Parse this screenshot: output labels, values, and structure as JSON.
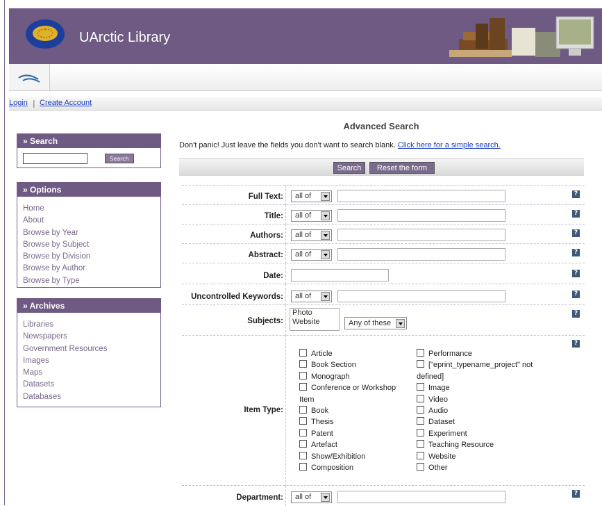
{
  "header": {
    "title": "UArctic Library"
  },
  "account": {
    "login": "Login",
    "separator": "|",
    "create": "Create Account"
  },
  "sidebar": {
    "search": {
      "heading": "» Search",
      "button": "Search"
    },
    "options": {
      "heading": "» Options",
      "items": [
        "Home",
        "About",
        "Browse by Year",
        "Browse by Subject",
        "Browse by Division",
        "Browse by Author",
        "Browse by Type"
      ]
    },
    "archives": {
      "heading": "» Archives",
      "items": [
        "Libraries",
        "Newspapers",
        "Government Resources",
        "Images",
        "Maps",
        "Datasets",
        "Databases"
      ]
    }
  },
  "main": {
    "title": "Advanced Search",
    "notice": "Don't panic! Just leave the fields you don't want to search blank.",
    "simple_link": "Click here for a simple search.",
    "search_button": "Search",
    "reset_button": "Reset the form",
    "help": "?",
    "fields": {
      "fulltext": {
        "label": "Full Text:",
        "select": "all of"
      },
      "title": {
        "label": "Title:",
        "select": "all of"
      },
      "authors": {
        "label": "Authors:",
        "select": "all of"
      },
      "abstract": {
        "label": "Abstract:",
        "select": "all of"
      },
      "date": {
        "label": "Date:"
      },
      "keywords": {
        "label": "Uncontrolled Keywords:",
        "select": "all of"
      },
      "subjects": {
        "label": "Subjects:",
        "options": [
          "Photo",
          "Website"
        ],
        "select": "Any of these"
      },
      "itemtype": {
        "label": "Item Type:"
      },
      "department": {
        "label": "Department:",
        "select": "all of"
      }
    },
    "item_types_left": [
      "Article",
      "Book Section",
      "Monograph",
      "Conference or Workshop Item",
      "Book",
      "Thesis",
      "Patent",
      "Artefact",
      "Show/Exhibition",
      "Composition"
    ],
    "item_types_right": [
      "Performance",
      "[\"eprint_typename_project\" not defined]",
      "Image",
      "Video",
      "Audio",
      "Dataset",
      "Experiment",
      "Teaching Resource",
      "Website",
      "Other"
    ]
  },
  "colors": {
    "brand": "#6e5a83",
    "link": "#1a3ec2"
  }
}
